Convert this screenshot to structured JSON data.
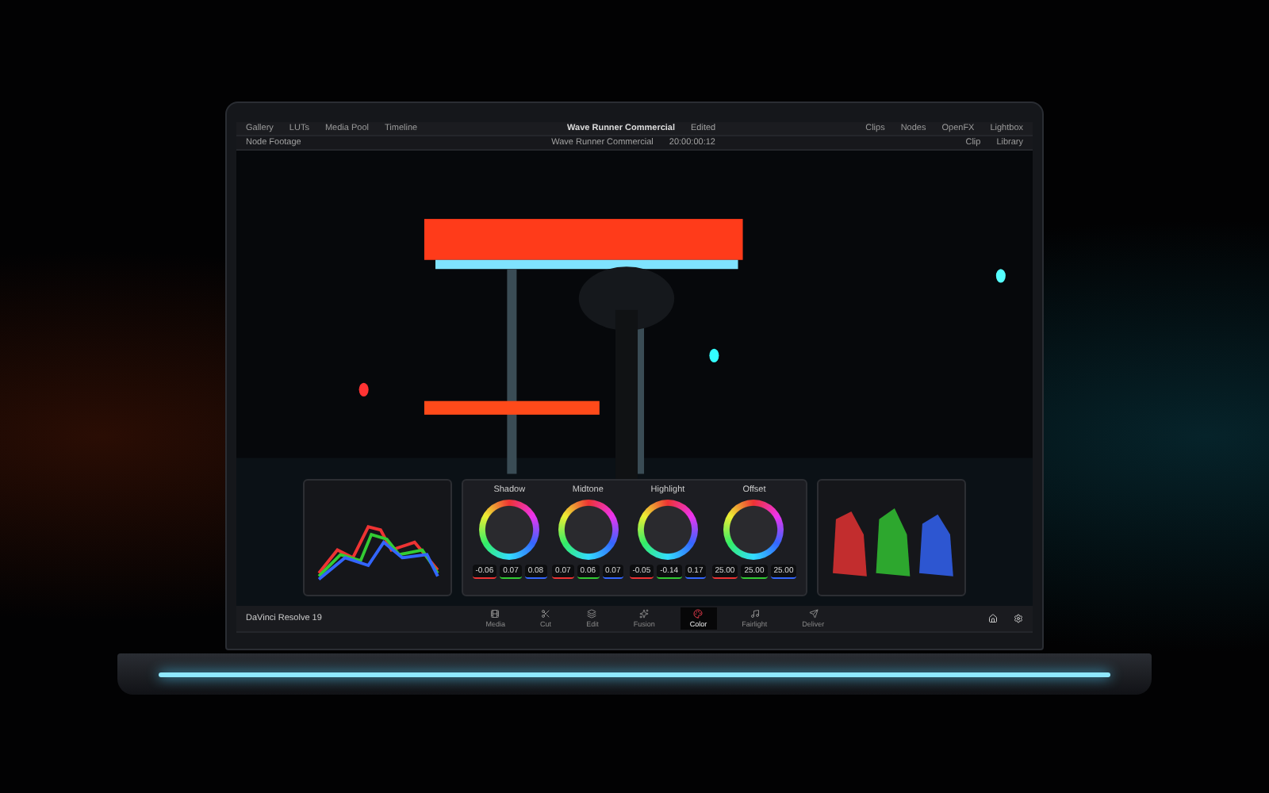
{
  "toolbar": {
    "left": [
      "Gallery",
      "LUTs",
      "Media Pool",
      "Timeline"
    ],
    "title": "Wave Runner Commercial",
    "status": "Edited",
    "right": [
      "Clips",
      "Nodes",
      "OpenFX",
      "Lightbox"
    ]
  },
  "viewer_bar": {
    "bin": "Node Footage",
    "timeline": "Wave Runner Commercial",
    "timecode": "20:00:00:12",
    "clip": "Clip",
    "library": "Library"
  },
  "color_wheels": [
    {
      "label": "Shadow",
      "values": [
        "-0.06",
        "0.07",
        "0.08"
      ]
    },
    {
      "label": "Midtone",
      "values": [
        "0.07",
        "0.06",
        "0.07"
      ]
    },
    {
      "label": "Highlight",
      "values": [
        "-0.05",
        "-0.14",
        "0.17"
      ]
    },
    {
      "label": "Offset",
      "values": [
        "25.00",
        "25.00",
        "25.00"
      ]
    }
  ],
  "bottom_bar": {
    "app_name": "DaVinci Resolve 19",
    "pages": [
      {
        "label": "Media",
        "selected": false
      },
      {
        "label": "Cut",
        "selected": false
      },
      {
        "label": "Edit",
        "selected": false
      },
      {
        "label": "Fusion",
        "selected": false
      },
      {
        "label": "Color",
        "selected": true
      },
      {
        "label": "Fairlight",
        "selected": false
      },
      {
        "label": "Deliver",
        "selected": false
      }
    ]
  }
}
